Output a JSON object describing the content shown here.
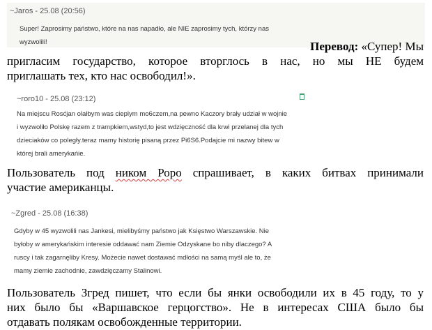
{
  "comments": [
    {
      "author_line": "~Jaros - 25.08 (20:56)",
      "lines": [
        "Super! Zaprosimy państwo, które na nas napadło, ale NIE zaprosimy tych, którzy nas",
        "wyzwolili!"
      ]
    },
    {
      "author_line": "~roro10 - 25.08 (23:12)",
      "lines": [
        "Na miejscu Rosćjan olałbym was cieplym mo6czem,na pewno Kaczory brały udział w wojnie",
        "i wyzwoliło Polskę razem z trampkiem,wstyd,to jest wdzięczność dla krwi przelanej dla tych",
        "dzieciaków co poległy.teraz mamy historię pisaną przez Pi6S6.Podajcie mi nazwy bitew w",
        "której brali amerykańie."
      ]
    },
    {
      "author_line": "~Zgred - 25.08 (16:38)",
      "lines": [
        "Gdyby w 45 wyzwolili nas Jankesi, mielibyśmy państwo jak Księstwo Warszawskie. Nie",
        "byłoby w amerykańskim interesie oddawać nam Ziemie Odzyskane bo niby dlaczego? A",
        "ruscy i tak zagarnęliby Kresy. Możecie nawet dostawać mdłości na samą myśl ale to, że",
        "mamy ziemie zachodnie, zawdzięczamy Stalinowi."
      ]
    }
  ],
  "translations": {
    "t1_label": "Перевод:",
    "t1_line1": "«Супер! Мы",
    "t1_line2": "пригласим государство, которое вторглось в нас, но мы НЕ будем",
    "t1_line3": "приглашать тех, кто нас освободил!».",
    "t2_line1_a": "Пользователь под ",
    "t2_line1_b": "ником Роро",
    "t2_line1_c": " спрашивает, в каких битвах принимали",
    "t2_line2": "участие американцы.",
    "t3_line1": "Пользователь Згред пишет, что если бы янки освободили их в 45 году, то у",
    "t3_line2": "них было бы «Варшавское герцогство». Не в интересах США  было бы",
    "t3_line3": "отдавать полякам освобожденные территории."
  },
  "colors": {
    "comment_bg": "#f6f6f3",
    "meta_text": "#555555",
    "spellcheck_underline": "#d23b3b",
    "icon": "#4a9e74"
  }
}
